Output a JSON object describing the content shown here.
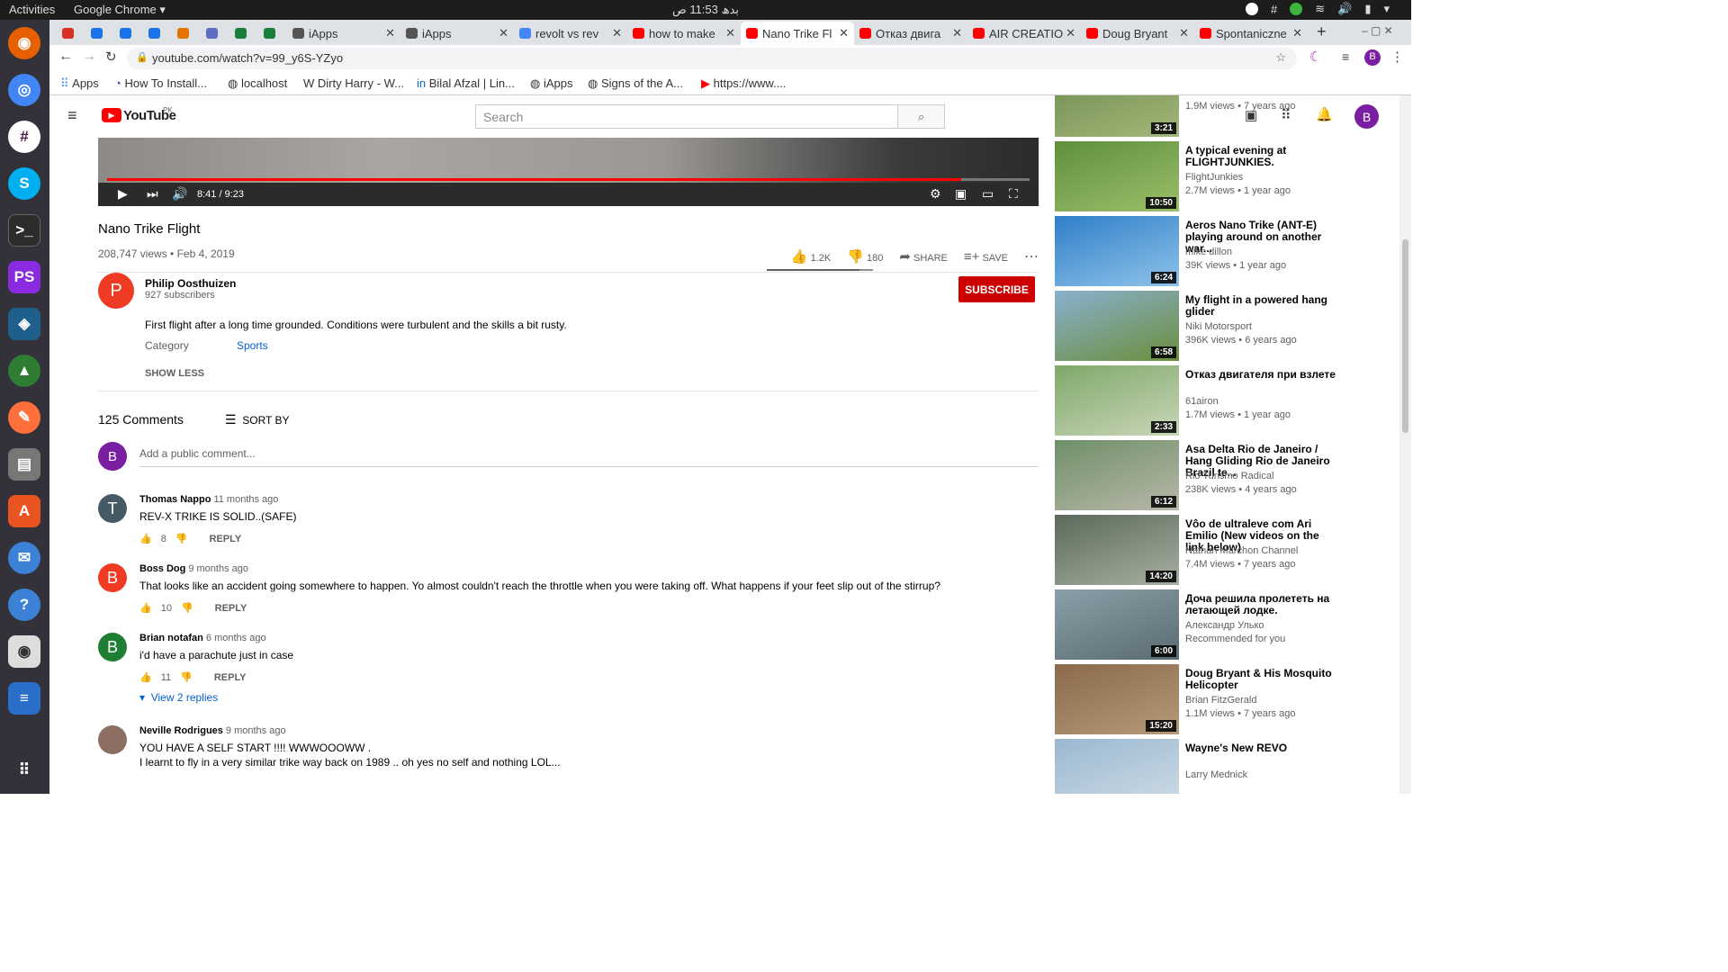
{
  "topbar": {
    "activities": "Activities",
    "app": "Google Chrome ▾",
    "clock": "بدھ 11:53 ص"
  },
  "tabs": [
    {
      "label": "",
      "color": "#d93025"
    },
    {
      "label": "",
      "color": "#1a73e8"
    },
    {
      "label": "",
      "color": "#1a73e8"
    },
    {
      "label": "",
      "color": "#1a73e8"
    },
    {
      "label": "",
      "color": "#e37400"
    },
    {
      "label": "",
      "color": "#5f6dc0"
    },
    {
      "label": "",
      "color": "#188038"
    },
    {
      "label": "",
      "color": "#188038"
    },
    {
      "label": "iApps",
      "color": "#555"
    },
    {
      "label": "iApps",
      "color": "#555"
    },
    {
      "label": "revolt vs rev",
      "color": "#4285f4"
    },
    {
      "label": "how to make",
      "color": "#ff0000"
    },
    {
      "label": "Nano Trike Fl",
      "color": "#ff0000"
    },
    {
      "label": "Отказ двига",
      "color": "#ff0000"
    },
    {
      "label": "AIR CREATIO",
      "color": "#ff0000"
    },
    {
      "label": "Doug Bryant",
      "color": "#ff0000"
    },
    {
      "label": "Spontaniczne",
      "color": "#ff0000"
    }
  ],
  "address": {
    "url": "youtube.com/watch?v=99_y6S-YZyo"
  },
  "bookmarks": [
    "Apps",
    "How To Install...",
    "localhost",
    "Dirty Harry - W...",
    "Bilal Afzal | Lin...",
    "iApps",
    "Signs of the A...",
    "https://www...."
  ],
  "youtube": {
    "logo": "YouTube",
    "region": "PK",
    "search_placeholder": "Search",
    "user_initial": "B"
  },
  "player": {
    "time": "8:41 / 9:23",
    "progress": 0.9254
  },
  "video": {
    "title": "Nano Trike Flight",
    "views_date": "208,747 views • Feb 4, 2019",
    "likes": "1.2K",
    "dislikes": "180",
    "share": "SHARE",
    "save": "SAVE"
  },
  "channel": {
    "name": "Philip Oosthuizen",
    "subscribers": "927 subscribers",
    "initial": "P",
    "subscribe": "SUBSCRIBE"
  },
  "description": {
    "text": "First flight after a long time grounded. Conditions were turbulent and the skills a bit rusty.",
    "category_label": "Category",
    "category": "Sports",
    "show_less": "SHOW LESS"
  },
  "comments_header": {
    "count": "125 Comments",
    "sort": "SORT BY",
    "add_placeholder": "Add a public comment...",
    "me_initial": "B"
  },
  "comments": [
    {
      "initial": "T",
      "color": "#455a64",
      "author": "Thomas Nappo",
      "time": "11 months ago",
      "text": "REV-X TRIKE IS SOLID..(SAFE)",
      "likes": "8",
      "reply": "REPLY"
    },
    {
      "initial": "B",
      "color": "#ef3b24",
      "author": "Boss Dog",
      "time": "9 months ago",
      "text": "That looks like an accident going somewhere to happen. Yo almost couldn't reach the throttle when you were taking off. What happens if your feet slip out of the stirrup?",
      "likes": "10",
      "reply": "REPLY"
    },
    {
      "initial": "B",
      "color": "#1e7e34",
      "author": "Brian notafan",
      "time": "6 months ago",
      "text": "i'd have a parachute just in case",
      "likes": "11",
      "reply": "REPLY",
      "view_replies": "View 2 replies"
    },
    {
      "initial": "",
      "color": "#8d6e63",
      "author": "Neville Rodrigues",
      "time": "9 months ago",
      "text": "YOU HAVE A SELF START !!!! WWWOOOWW .",
      "text2": "I  learnt to  fly in a very similar trike way back on 1989  .. oh yes  no self and nothing LOL..."
    }
  ],
  "related": [
    {
      "title": "",
      "channel": "",
      "meta": "1.9M views • 7 years ago",
      "duration": "3:21",
      "c1": "#6d8c4e",
      "c2": "#a4b77a"
    },
    {
      "title": "A typical evening at FLIGHTJUNKIES.",
      "channel": "FlightJunkies",
      "meta": "2.7M views • 1 year ago",
      "duration": "10:50",
      "c1": "#5f8f3e",
      "c2": "#9cbf6a"
    },
    {
      "title": "Aeros Nano Trike (ANT-E) playing around on another war...",
      "channel": "mike dillon",
      "meta": "39K views • 1 year ago",
      "duration": "6:24",
      "c1": "#2f7fc8",
      "c2": "#8fc3ea"
    },
    {
      "title": "My flight in a powered hang glider",
      "channel": "Niki Motorsport",
      "meta": "396K views • 6 years ago",
      "duration": "6:58",
      "c1": "#8ab0d0",
      "c2": "#6b8e3a"
    },
    {
      "title": "Отказ двигателя при взлете",
      "channel": "61airon",
      "meta": "1.7M views • 1 year ago",
      "duration": "2:33",
      "c1": "#7fa86a",
      "c2": "#c9d6b8"
    },
    {
      "title": "Asa Delta Rio de Janeiro / Hang Gliding Rio de Janeiro Brazil te...",
      "channel": "Rio Turismo Radical",
      "meta": "238K views • 4 years ago",
      "duration": "6:12",
      "c1": "#6f8f6a",
      "c2": "#b8b8a8"
    },
    {
      "title": "Vôo de ultraleve com Ari Emilio (New videos on the link below)",
      "channel": "Nathan Marchon Channel",
      "meta": "7.4M views • 7 years ago",
      "duration": "14:20",
      "c1": "#5a6a5a",
      "c2": "#a8b0a0"
    },
    {
      "title": "Доча решила пролететь на летающей лодке.",
      "channel": "Александр Улько",
      "meta": "Recommended for you",
      "duration": "6:00",
      "c1": "#8aa0a8",
      "c2": "#5a6a72"
    },
    {
      "title": "Doug Bryant & His Mosquito Helicopter",
      "channel": "Brian FitzGerald",
      "meta": "1.1M views • 7 years ago",
      "duration": "15:20",
      "c1": "#8a6a4a",
      "c2": "#b59a7a"
    },
    {
      "title": "Wayne's New REVO",
      "channel": "Larry Mednick",
      "meta": "",
      "duration": "",
      "c1": "#9ab8d0",
      "c2": "#d0dce6"
    }
  ]
}
